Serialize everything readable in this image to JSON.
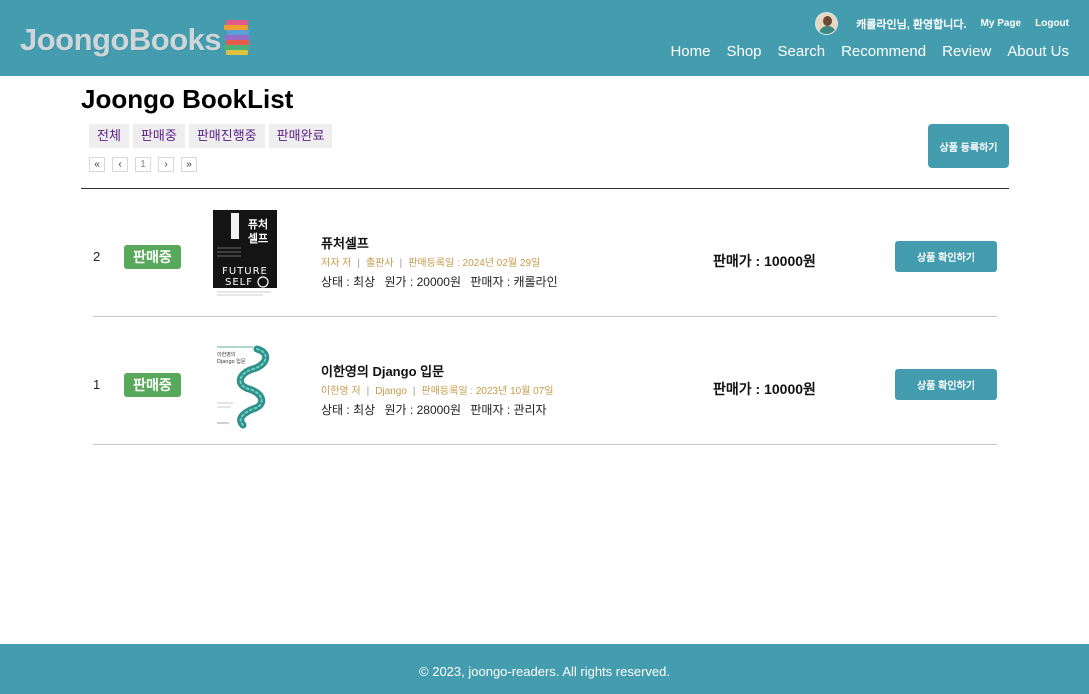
{
  "header": {
    "logo_text": "JoongoBooks",
    "welcome": "캐롤라인님, 환영합니다.",
    "my_page": "My Page",
    "logout": "Logout",
    "nav": [
      "Home",
      "Shop",
      "Search",
      "Recommend",
      "Review",
      "About Us"
    ],
    "bg_color": "#449daf"
  },
  "main": {
    "title": "Joongo BookList",
    "filters": [
      "전체",
      "판매중",
      "판매진행중",
      "판매완료"
    ],
    "pagination": {
      "first": "«",
      "prev": "‹",
      "current": "1",
      "next": "›",
      "last": "»"
    },
    "register_button": "상품 등록하기"
  },
  "books": [
    {
      "number": "2",
      "status": "판매중",
      "title": "퓨처셀프",
      "author": "저자 저",
      "publisher": "출판사",
      "registered": "판매등록일 : 2024년 02월 29일",
      "condition": "상태 : 최상",
      "original_price": "원가 : 20000원",
      "seller": "판매자 : 캐롤라인",
      "price": "판매가 : 10000원",
      "check_button": "상품 확인하기",
      "cover_text": [
        "퓨처",
        "셀프",
        "FUTURE",
        "SELF"
      ]
    },
    {
      "number": "1",
      "status": "판매중",
      "title": "이한영의 Django 입문",
      "author": "이한영 저",
      "publisher": "Django",
      "registered": "판매등록일 : 2023년 10월 07일",
      "condition": "상태 : 최상",
      "original_price": "원가 : 28000원",
      "seller": "판매자 : 관리자",
      "price": "판매가 : 10000원",
      "check_button": "상품 확인하기",
      "cover_text": [
        "이한영의",
        "Django 입문"
      ]
    }
  ],
  "footer": {
    "text": "© 2023, joongo-readers. All rights reserved."
  }
}
